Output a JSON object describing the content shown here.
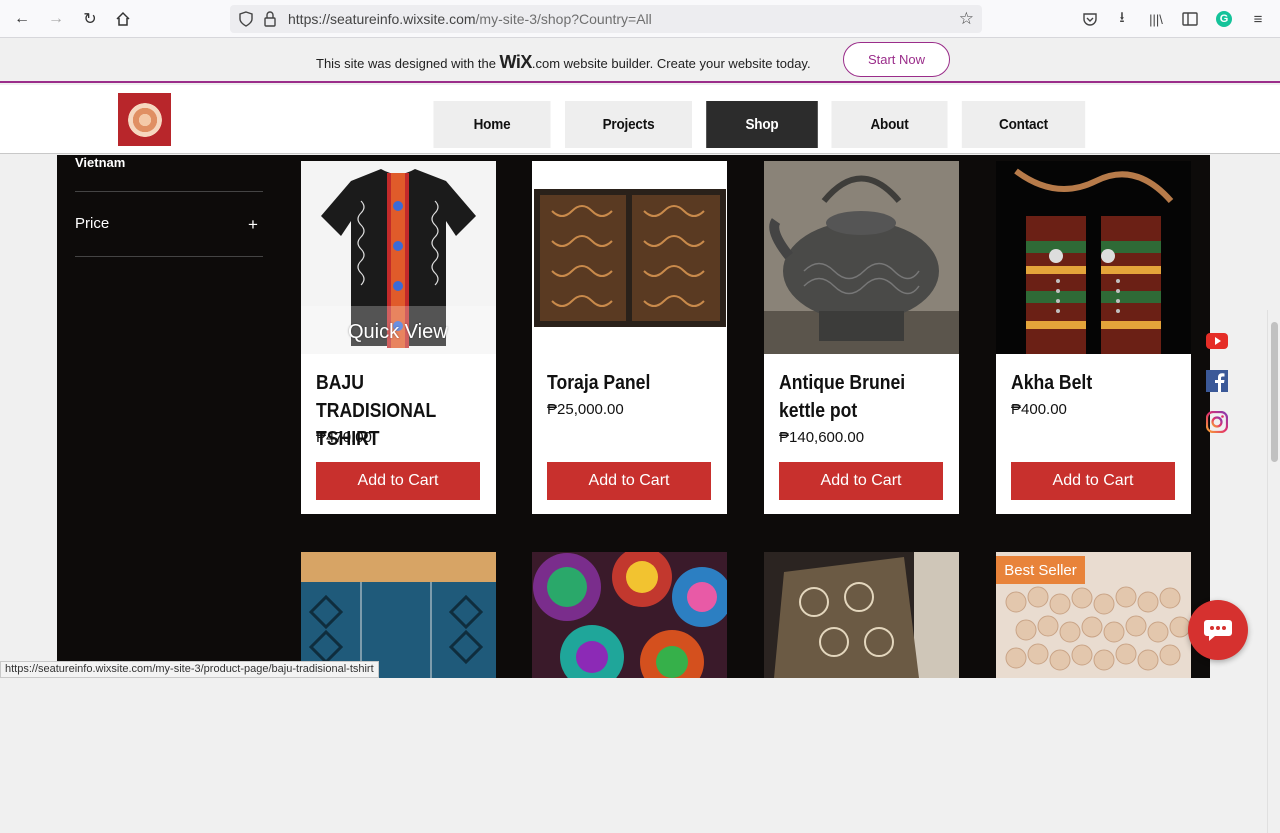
{
  "browser": {
    "url_host": "https://seatureinfo.wixsite.com",
    "url_path": "/my-site-3/shop?Country=All",
    "status_url": "https://seatureinfo.wixsite.com/my-site-3/product-page/baju-tradisional-tshirt"
  },
  "wix_banner": {
    "text_before": "This site was designed with the ",
    "brand": "WiX",
    "text_after": ".com website builder. Create your website today.",
    "button": "Start Now"
  },
  "nav": {
    "items": [
      "Home",
      "Projects",
      "Shop",
      "About",
      "Contact"
    ],
    "active": "Shop"
  },
  "filters": {
    "country_value": "Vietnam",
    "price_label": "Price",
    "price_toggle": "+"
  },
  "products": [
    {
      "name": "BAJU TRADISIONAL TSHIRT",
      "price": "₱470.00",
      "button": "Add to Cart",
      "overlay": "Quick View"
    },
    {
      "name": "Toraja Panel",
      "price": "₱25,000.00",
      "button": "Add to Cart"
    },
    {
      "name": "Antique Brunei kettle pot",
      "price": "₱140,600.00",
      "button": "Add to Cart"
    },
    {
      "name": "Akha Belt",
      "price": "₱400.00",
      "button": "Add to Cart"
    }
  ],
  "second_row": {
    "badge": "Best Seller"
  },
  "colors": {
    "accent": "#c8302d",
    "wix_purple": "#9a2d8a",
    "panel": "#0d0b0a"
  }
}
